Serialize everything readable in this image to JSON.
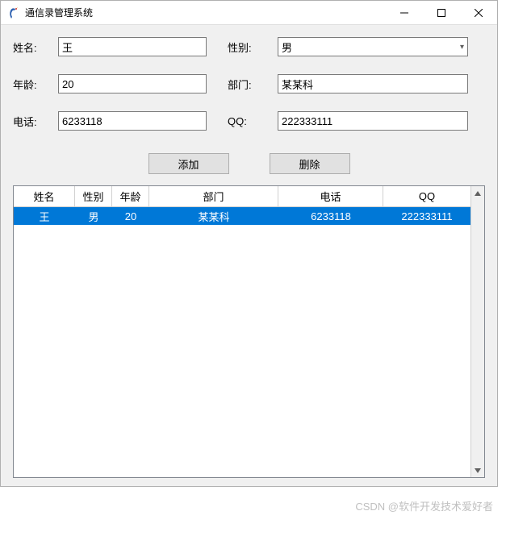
{
  "window": {
    "title": "通信录管理系统"
  },
  "form": {
    "name_label": "姓名:",
    "name_value": "王",
    "gender_label": "性别:",
    "gender_value": "男",
    "age_label": "年龄:",
    "age_value": "20",
    "dept_label": "部门:",
    "dept_value": "某某科",
    "phone_label": "电话:",
    "phone_value": "6233118",
    "qq_label": "QQ:",
    "qq_value": "222333111"
  },
  "buttons": {
    "add": "添加",
    "delete": "删除"
  },
  "table": {
    "headers": {
      "name": "姓名",
      "gender": "性别",
      "age": "年龄",
      "dept": "部门",
      "phone": "电话",
      "qq": "QQ"
    },
    "rows": [
      {
        "name": "王",
        "gender": "男",
        "age": "20",
        "dept": "某某科",
        "phone": "6233118",
        "qq": "222333111"
      }
    ]
  },
  "watermark": "CSDN @软件开发技术爱好者"
}
